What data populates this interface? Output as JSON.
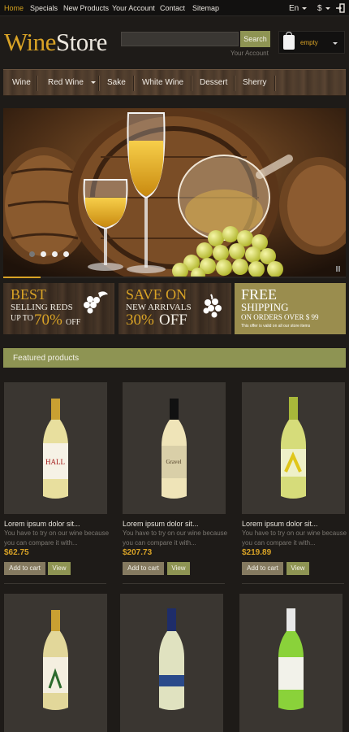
{
  "topbar": {
    "links": [
      "Home",
      "Specials",
      "New Products",
      "Your Account",
      "Contact",
      "Sitemap"
    ],
    "language": "En",
    "currency": "$"
  },
  "header": {
    "logo_part1": "Wine",
    "logo_part2": "Store",
    "search_button": "Search",
    "search_placeholder": "",
    "account_link": "Your Account",
    "cart_status": "empty"
  },
  "nav": {
    "items": [
      "Wine",
      "Red Wine",
      "Sake",
      "White Wine",
      "Dessert",
      "Sherry"
    ]
  },
  "slider": {
    "slide_count": 4,
    "active_slide": 1,
    "progress": 0.11
  },
  "promos": [
    {
      "line1": "BEST",
      "line2": "SELLING REDS",
      "line3": "UP TO",
      "percent": "70%",
      "off": "OFF"
    },
    {
      "line1": "SAVE ON",
      "line2": "NEW ARRIVALS",
      "percent": "30%",
      "off": "OFF"
    },
    {
      "line1": "FREE",
      "line2": "SHIPPING",
      "line3": "ON ORDERS OVER $ 99",
      "note": "This offer is valid on all our  store items"
    }
  ],
  "featured": {
    "title": "Featured products"
  },
  "products": [
    {
      "name": "Lorem ipsum dolor sit...",
      "desc": "You have to try on our wine because you can compare it with...",
      "price": "$62.75",
      "add_to_cart": "Add to cart",
      "view": "View"
    },
    {
      "name": "Lorem ipsum dolor sit...",
      "desc": "You have to try on our wine because you can compare it with...",
      "price": "$207.73",
      "add_to_cart": "Add to cart",
      "view": "View"
    },
    {
      "name": "Lorem ipsum dolor sit...",
      "desc": "You have to try on our wine because you can compare it with...",
      "price": "$219.89",
      "add_to_cart": "Add to cart",
      "view": "View"
    },
    {
      "name": "",
      "desc": "",
      "price": ""
    },
    {
      "name": "",
      "desc": "",
      "price": ""
    },
    {
      "name": "",
      "desc": "",
      "price": ""
    }
  ],
  "colors": {
    "accent_gold": "#d9a326",
    "olive": "#8e9453",
    "background": "#1e1b18"
  }
}
